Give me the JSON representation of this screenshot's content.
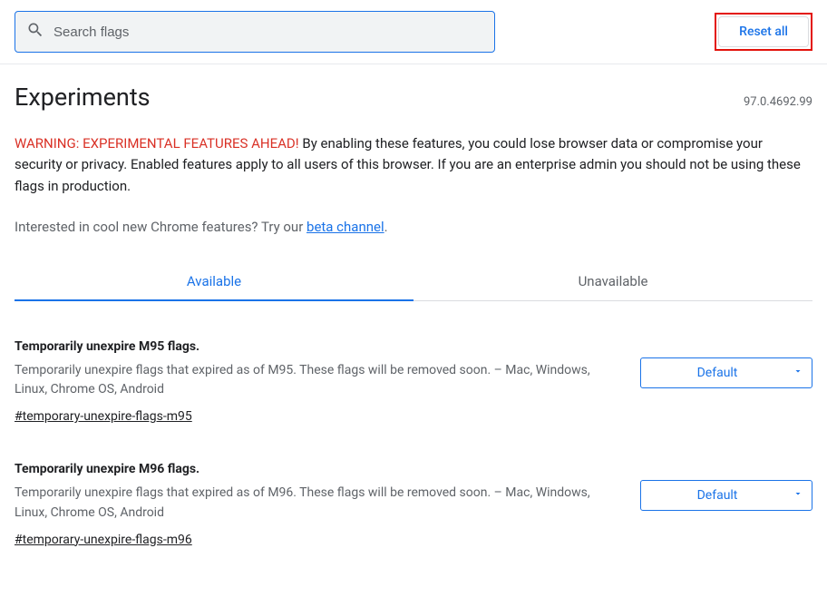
{
  "search": {
    "placeholder": "Search flags"
  },
  "reset_label": "Reset all",
  "page_title": "Experiments",
  "version": "97.0.4692.99",
  "warning": {
    "prefix": "WARNING: EXPERIMENTAL FEATURES AHEAD!",
    "body": " By enabling these features, you could lose browser data or compromise your security or privacy. Enabled features apply to all users of this browser. If you are an enterprise admin you should not be using these flags in production."
  },
  "cta": {
    "lead": "Interested in cool new Chrome features? Try our ",
    "link_text": "beta channel",
    "period": "."
  },
  "tabs": {
    "available": "Available",
    "unavailable": "Unavailable"
  },
  "flags": [
    {
      "title": "Temporarily unexpire M95 flags.",
      "desc": "Temporarily unexpire flags that expired as of M95. These flags will be removed soon. – Mac, Windows, Linux, Chrome OS, Android",
      "hash": "#temporary-unexpire-flags-m95",
      "selected": "Default"
    },
    {
      "title": "Temporarily unexpire M96 flags.",
      "desc": "Temporarily unexpire flags that expired as of M96. These flags will be removed soon. – Mac, Windows, Linux, Chrome OS, Android",
      "hash": "#temporary-unexpire-flags-m96",
      "selected": "Default"
    }
  ]
}
